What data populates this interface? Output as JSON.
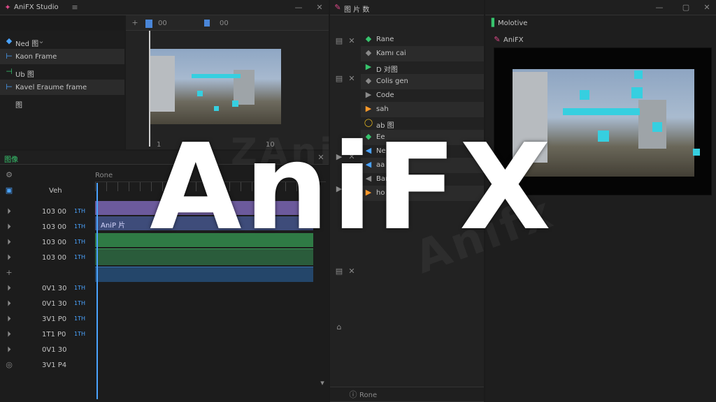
{
  "top_left": {
    "title": "AniFX Studio",
    "tab_time_left": "00",
    "tab_time_right": "00"
  },
  "keyframe_panel": {
    "header": "Ned 图",
    "items": [
      "Kaon Frame",
      "Ub 图",
      "Kavel Eraume frame",
      "图"
    ]
  },
  "preview_small": {
    "footer_left": "1",
    "footer_right": "10"
  },
  "timeline": {
    "header": "图像",
    "ruler_label": "Rone",
    "track_label": "Veh",
    "tracks": [
      {
        "time": "103 00",
        "badge": "1TH"
      },
      {
        "time": "103 00",
        "badge": "1TH"
      },
      {
        "time": "103 00",
        "badge": "1TH"
      },
      {
        "time": "103 00",
        "badge": "1TH"
      },
      {
        "time": "",
        "badge": ""
      },
      {
        "time": "0V1 30",
        "badge": "1TH"
      },
      {
        "time": "0V1 30",
        "badge": "1TH"
      },
      {
        "time": "3V1 P0",
        "badge": "1TH"
      },
      {
        "time": "1T1 P0",
        "badge": "1TH"
      },
      {
        "time": "0V1 30",
        "badge": ""
      },
      {
        "time": "3V1 P4",
        "badge": ""
      }
    ],
    "clip_label": "AniP 片",
    "playhead": "25"
  },
  "middle_panel": {
    "title": "图 片 数",
    "items": [
      "Rane",
      "Kamı cai",
      "D 对图",
      "Colis gen",
      "Code",
      "sah",
      "ab 图",
      "Ee",
      "Ne",
      "aa",
      "Ban",
      "ho"
    ],
    "footer": "Rone"
  },
  "right_panel": {
    "tab": "Molotive",
    "preview_label": "AniFX"
  },
  "watermark": {
    "main": "AniFX",
    "ghost1": "ZAni",
    "ghost2": "Anifx"
  },
  "colors": {
    "accent_blue": "#4aa3ff",
    "cyan_particle": "#36cfe0",
    "green": "#37c46d",
    "orange": "#ff9a2a",
    "purple_clip": "#6c5a9c",
    "green_clip": "#2f7a45"
  }
}
